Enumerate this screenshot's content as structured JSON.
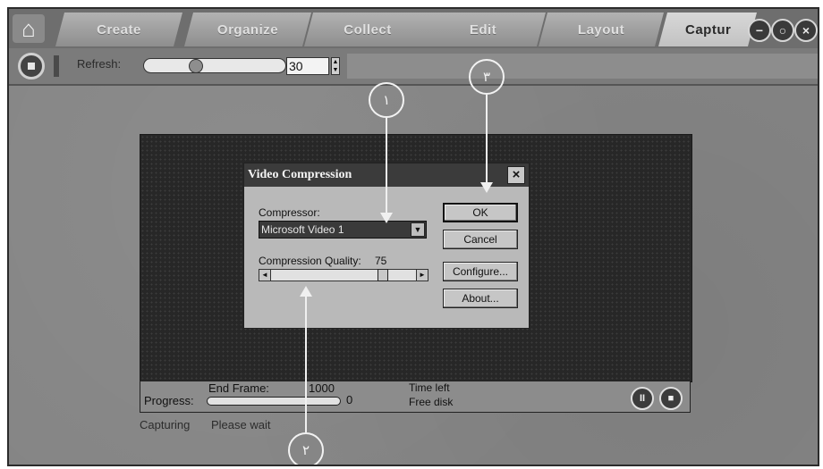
{
  "tabs": [
    {
      "label": "Create"
    },
    {
      "label": "Organize"
    },
    {
      "label": "Collect"
    },
    {
      "label": "Edit"
    },
    {
      "label": "Layout"
    },
    {
      "label": "Captur"
    }
  ],
  "toolbar": {
    "refresh_label": "Refresh:",
    "refresh_value": "30"
  },
  "capture": {
    "progress_label": "Progress:",
    "end_frame_label": "End Frame:",
    "end_frame_value": "1000",
    "progress_value": "0",
    "time_left_label": "Time left",
    "free_disk_label": "Free disk",
    "status": "Capturing",
    "status_message": "Please wait"
  },
  "dialog": {
    "title": "Video Compression",
    "compressor_label": "Compressor:",
    "compressor_value": "Microsoft Video 1",
    "quality_label": "Compression Quality:",
    "quality_value": "75",
    "ok_label": "OK",
    "cancel_label": "Cancel",
    "configure_label": "Configure...",
    "about_label": "About..."
  },
  "callouts": {
    "c1": "١",
    "c2": "٢",
    "c3": "٣"
  },
  "icons": {
    "home": "home-icon",
    "close": "close-icon"
  }
}
